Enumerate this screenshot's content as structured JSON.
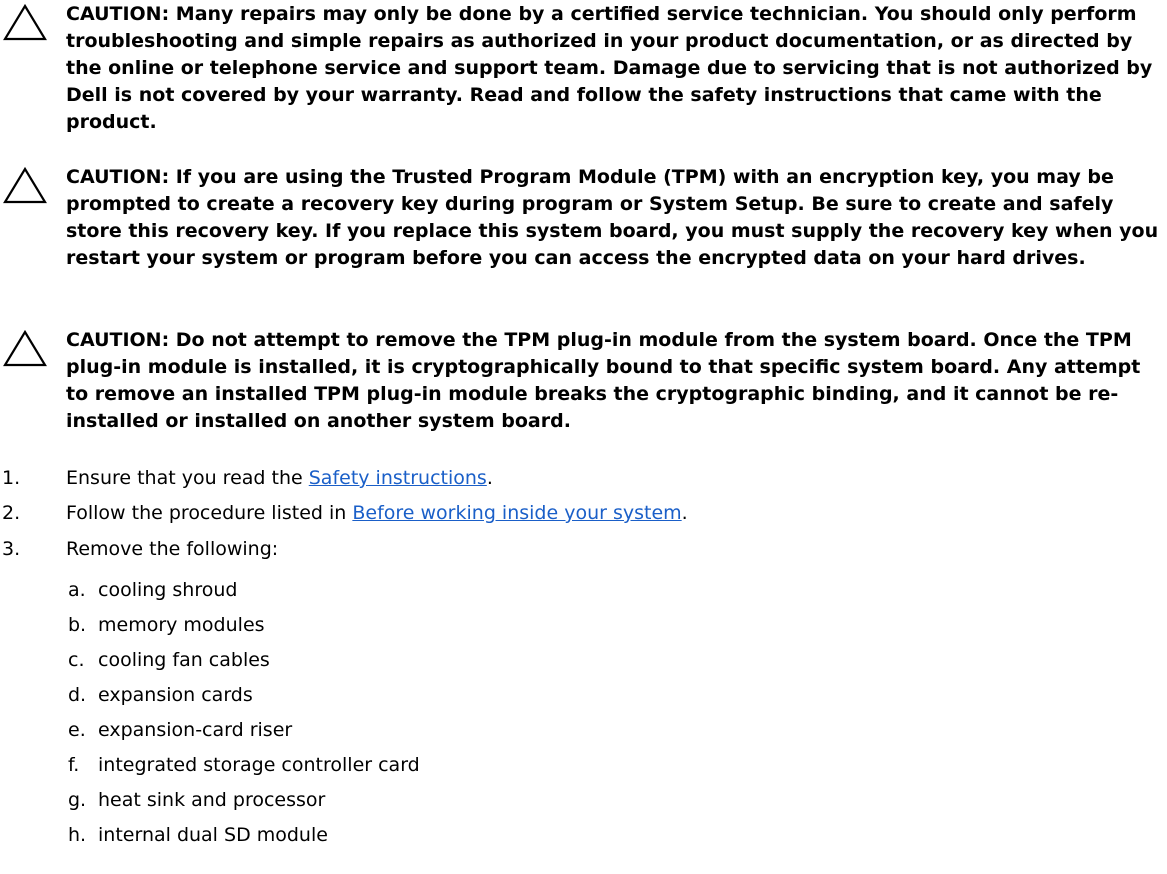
{
  "cautions": [
    "CAUTION: Many repairs may only be done by a certified service technician. You should only perform troubleshooting and simple repairs as authorized in your product documentation, or as directed by the online or telephone service and support team. Damage due to servicing that is not authorized by Dell is not covered by your warranty. Read and follow the safety instructions that came with the product.",
    "CAUTION: If you are using the Trusted Program Module (TPM) with an encryption key, you may be prompted to create a recovery key during program or System Setup. Be sure to create and safely store this recovery key. If you replace this system board, you must supply the recovery key when you restart your system or program before you can access the encrypted data on your hard drives.",
    "CAUTION: Do not attempt to remove the TPM plug-in module from the system board. Once the TPM plug-in module is installed, it is cryptographically bound to that specific system board. Any attempt to remove an installed TPM plug-in module breaks the cryptographic binding, and it cannot be re-installed or installed on another system board."
  ],
  "steps": [
    {
      "number": "1.",
      "prefix": "Ensure that you read the ",
      "link": "Safety instructions",
      "suffix": "."
    },
    {
      "number": "2.",
      "prefix": "Follow the procedure listed in ",
      "link": "Before working inside your system",
      "suffix": "."
    },
    {
      "number": "3.",
      "text": "Remove the following:"
    }
  ],
  "remove_items": [
    {
      "letter": "a.",
      "text": "cooling shroud"
    },
    {
      "letter": "b.",
      "text": "memory modules"
    },
    {
      "letter": "c.",
      "text": "cooling fan cables"
    },
    {
      "letter": "d.",
      "text": "expansion cards"
    },
    {
      "letter": "e.",
      "text": "expansion-card riser"
    },
    {
      "letter": "f.",
      "text": "integrated storage controller card"
    },
    {
      "letter": "g.",
      "text": "heat sink and processor"
    },
    {
      "letter": "h.",
      "text": "internal dual SD module"
    }
  ],
  "link_color": "#1a5fc8"
}
